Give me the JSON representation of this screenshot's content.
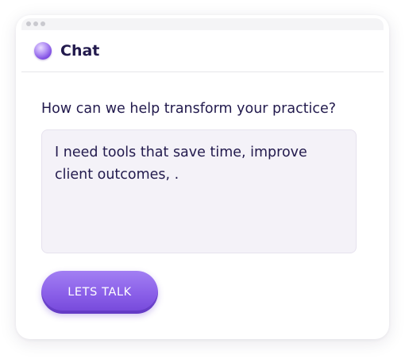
{
  "header": {
    "title": "Chat",
    "logo_icon": "purple-orb-icon"
  },
  "form": {
    "question": "How can we help transform your practice?",
    "message_value": "I need tools that save time, improve client outcomes, .",
    "submit_label": "LETS TALK"
  },
  "colors": {
    "accent": "#8a5fe8",
    "text": "#221a4d",
    "field_background": "#f4f2f8"
  }
}
